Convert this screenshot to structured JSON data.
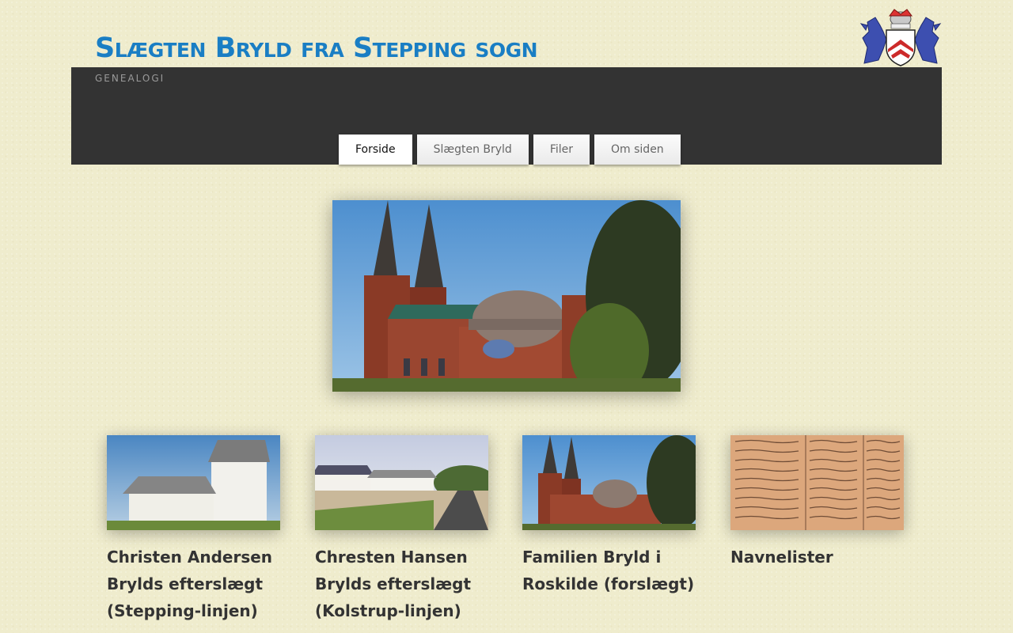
{
  "site": {
    "title": "Slægten Bryld fra Stepping sogn",
    "tagline": "Genealogi"
  },
  "nav": {
    "tabs": [
      {
        "label": "Forside",
        "active": true
      },
      {
        "label": "Slægten Bryld",
        "active": false
      },
      {
        "label": "Filer",
        "active": false
      },
      {
        "label": "Om siden",
        "active": false
      }
    ]
  },
  "cards": [
    {
      "title": "Christen Andersen Brylds efterslægt (Stepping-linjen)"
    },
    {
      "title": "Chresten Hansen Brylds efterslægt (Kolstrup-linjen)"
    },
    {
      "title": "Familien Bryld i Roskilde (forslægt)"
    },
    {
      "title": "Navnelister"
    }
  ],
  "colors": {
    "title_blue": "#1a7ec4",
    "header_bar": "#333333",
    "page_bg": "#efeccd",
    "card_title": "#333333"
  }
}
